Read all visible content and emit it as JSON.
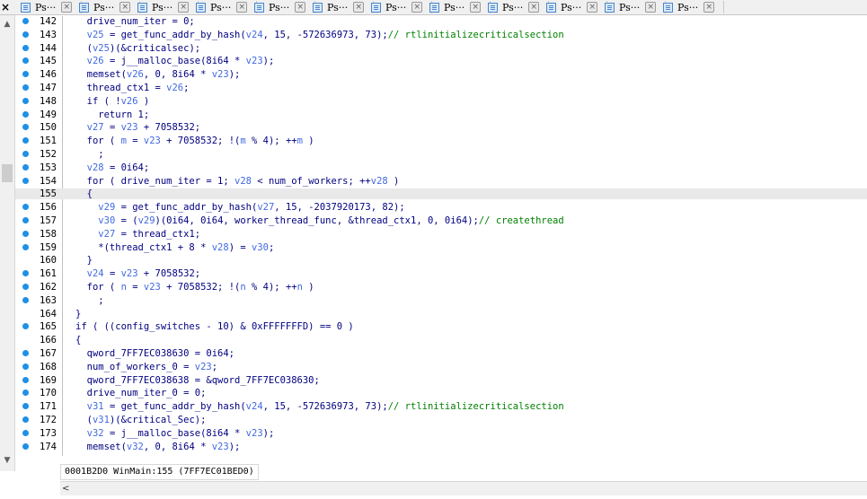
{
  "window_controls": {
    "close_glyph": "×"
  },
  "tabs": [
    {
      "label": "Ps···"
    },
    {
      "label": "Ps···"
    },
    {
      "label": "Ps···"
    },
    {
      "label": "Ps···"
    },
    {
      "label": "Ps···"
    },
    {
      "label": "Ps···"
    },
    {
      "label": "Ps···"
    },
    {
      "label": "Ps···"
    },
    {
      "label": "Ps···"
    },
    {
      "label": "Ps···"
    },
    {
      "label": "Ps···"
    },
    {
      "label": "Ps···"
    }
  ],
  "scrollbar": {
    "up_glyph": "▲",
    "down_glyph": "▼",
    "left_glyph": "<"
  },
  "code_lines": [
    {
      "num": "142",
      "bp": true,
      "segs": [
        [
          "k",
          "  drive_num_iter = 0;"
        ]
      ]
    },
    {
      "num": "143",
      "bp": true,
      "segs": [
        [
          "k",
          "  "
        ],
        [
          "v",
          "v25"
        ],
        [
          "k",
          " = get_func_addr_by_hash("
        ],
        [
          "v",
          "v24"
        ],
        [
          "k",
          ", 15, -572636973, 73);"
        ],
        [
          "c",
          "// rtlinitializecriticalsection"
        ]
      ]
    },
    {
      "num": "144",
      "bp": true,
      "segs": [
        [
          "k",
          "  ("
        ],
        [
          "v",
          "v25"
        ],
        [
          "k",
          ")(&criticalsec);"
        ]
      ]
    },
    {
      "num": "145",
      "bp": true,
      "segs": [
        [
          "k",
          "  "
        ],
        [
          "v",
          "v26"
        ],
        [
          "k",
          " = j__malloc_base(8i64 * "
        ],
        [
          "v",
          "v23"
        ],
        [
          "k",
          ");"
        ]
      ]
    },
    {
      "num": "146",
      "bp": true,
      "segs": [
        [
          "k",
          "  memset("
        ],
        [
          "v",
          "v26"
        ],
        [
          "k",
          ", 0, 8i64 * "
        ],
        [
          "v",
          "v23"
        ],
        [
          "k",
          ");"
        ]
      ]
    },
    {
      "num": "147",
      "bp": true,
      "segs": [
        [
          "k",
          "  thread_ctx1 = "
        ],
        [
          "v",
          "v26"
        ],
        [
          "k",
          ";"
        ]
      ]
    },
    {
      "num": "148",
      "bp": true,
      "segs": [
        [
          "k",
          "  if ( !"
        ],
        [
          "v",
          "v26"
        ],
        [
          "k",
          " )"
        ]
      ]
    },
    {
      "num": "149",
      "bp": true,
      "segs": [
        [
          "k",
          "    return 1;"
        ]
      ]
    },
    {
      "num": "150",
      "bp": true,
      "segs": [
        [
          "k",
          "  "
        ],
        [
          "v",
          "v27"
        ],
        [
          "k",
          " = "
        ],
        [
          "v",
          "v23"
        ],
        [
          "k",
          " + 7058532;"
        ]
      ]
    },
    {
      "num": "151",
      "bp": true,
      "segs": [
        [
          "k",
          "  for ( "
        ],
        [
          "v",
          "m"
        ],
        [
          "k",
          " = "
        ],
        [
          "v",
          "v23"
        ],
        [
          "k",
          " + 7058532; !("
        ],
        [
          "v",
          "m"
        ],
        [
          "k",
          " % 4); ++"
        ],
        [
          "v",
          "m"
        ],
        [
          "k",
          " )"
        ]
      ]
    },
    {
      "num": "152",
      "bp": true,
      "segs": [
        [
          "k",
          "    ;"
        ]
      ]
    },
    {
      "num": "153",
      "bp": true,
      "segs": [
        [
          "k",
          "  "
        ],
        [
          "v",
          "v28"
        ],
        [
          "k",
          " = 0i64;"
        ]
      ]
    },
    {
      "num": "154",
      "bp": true,
      "segs": [
        [
          "k",
          "  for ( drive_num_iter = 1; "
        ],
        [
          "v",
          "v28"
        ],
        [
          "k",
          " < num_of_workers; ++"
        ],
        [
          "v",
          "v28"
        ],
        [
          "k",
          " )"
        ]
      ]
    },
    {
      "num": "155",
      "bp": false,
      "hl": true,
      "segs": [
        [
          "k",
          "  {"
        ]
      ]
    },
    {
      "num": "156",
      "bp": true,
      "segs": [
        [
          "k",
          "    "
        ],
        [
          "v",
          "v29"
        ],
        [
          "k",
          " = get_func_addr_by_hash("
        ],
        [
          "v",
          "v27"
        ],
        [
          "k",
          ", 15, -2037920173, 82);"
        ]
      ]
    },
    {
      "num": "157",
      "bp": true,
      "segs": [
        [
          "k",
          "    "
        ],
        [
          "v",
          "v30"
        ],
        [
          "k",
          " = ("
        ],
        [
          "v",
          "v29"
        ],
        [
          "k",
          ")(0i64, 0i64, worker_thread_func, &thread_ctx1, 0, 0i64);"
        ],
        [
          "c",
          "// createthread"
        ]
      ]
    },
    {
      "num": "158",
      "bp": true,
      "segs": [
        [
          "k",
          "    "
        ],
        [
          "v",
          "v27"
        ],
        [
          "k",
          " = thread_ctx1;"
        ]
      ]
    },
    {
      "num": "159",
      "bp": true,
      "segs": [
        [
          "k",
          "    *(thread_ctx1 + 8 * "
        ],
        [
          "v",
          "v28"
        ],
        [
          "k",
          ") = "
        ],
        [
          "v",
          "v30"
        ],
        [
          "k",
          ";"
        ]
      ]
    },
    {
      "num": "160",
      "bp": false,
      "segs": [
        [
          "k",
          "  }"
        ]
      ]
    },
    {
      "num": "161",
      "bp": true,
      "segs": [
        [
          "k",
          "  "
        ],
        [
          "v",
          "v24"
        ],
        [
          "k",
          " = "
        ],
        [
          "v",
          "v23"
        ],
        [
          "k",
          " + 7058532;"
        ]
      ]
    },
    {
      "num": "162",
      "bp": true,
      "segs": [
        [
          "k",
          "  for ( "
        ],
        [
          "v",
          "n"
        ],
        [
          "k",
          " = "
        ],
        [
          "v",
          "v23"
        ],
        [
          "k",
          " + 7058532; !("
        ],
        [
          "v",
          "n"
        ],
        [
          "k",
          " % 4); ++"
        ],
        [
          "v",
          "n"
        ],
        [
          "k",
          " )"
        ]
      ]
    },
    {
      "num": "163",
      "bp": true,
      "segs": [
        [
          "k",
          "    ;"
        ]
      ]
    },
    {
      "num": "164",
      "bp": false,
      "segs": [
        [
          "k",
          "}"
        ]
      ]
    },
    {
      "num": "165",
      "bp": true,
      "segs": [
        [
          "k",
          "if ( ((config_switches - 10) & 0xFFFFFFFD) == 0 )"
        ]
      ]
    },
    {
      "num": "166",
      "bp": false,
      "segs": [
        [
          "k",
          "{"
        ]
      ]
    },
    {
      "num": "167",
      "bp": true,
      "segs": [
        [
          "k",
          "  qword_7FF7EC038630 = 0i64;"
        ]
      ]
    },
    {
      "num": "168",
      "bp": true,
      "segs": [
        [
          "k",
          "  num_of_workers_0 = "
        ],
        [
          "v",
          "v23"
        ],
        [
          "k",
          ";"
        ]
      ]
    },
    {
      "num": "169",
      "bp": true,
      "segs": [
        [
          "k",
          "  qword_7FF7EC038638 = &qword_7FF7EC038630;"
        ]
      ]
    },
    {
      "num": "170",
      "bp": true,
      "segs": [
        [
          "k",
          "  drive_num_iter_0 = 0;"
        ]
      ]
    },
    {
      "num": "171",
      "bp": true,
      "segs": [
        [
          "k",
          "  "
        ],
        [
          "v",
          "v31"
        ],
        [
          "k",
          " = get_func_addr_by_hash("
        ],
        [
          "v",
          "v24"
        ],
        [
          "k",
          ", 15, -572636973, 73);"
        ],
        [
          "c",
          "// rtlinitializecriticalsection"
        ]
      ]
    },
    {
      "num": "172",
      "bp": true,
      "segs": [
        [
          "k",
          "  ("
        ],
        [
          "v",
          "v31"
        ],
        [
          "k",
          ")(&critical_Sec);"
        ]
      ]
    },
    {
      "num": "173",
      "bp": true,
      "segs": [
        [
          "k",
          "  "
        ],
        [
          "v",
          "v32"
        ],
        [
          "k",
          " = j__malloc_base(8i64 * "
        ],
        [
          "v",
          "v23"
        ],
        [
          "k",
          ");"
        ]
      ]
    },
    {
      "num": "174",
      "bp": true,
      "segs": [
        [
          "k",
          "  memset("
        ],
        [
          "v",
          "v32"
        ],
        [
          "k",
          ", 0, 8i64 * "
        ],
        [
          "v",
          "v23"
        ],
        [
          "k",
          ");"
        ]
      ]
    }
  ],
  "status": {
    "text": "0001B2D0 WinMain:155 (7FF7EC01BED0)"
  },
  "colors": {
    "keyword_text": "#000080",
    "variable": "#4169e1",
    "comment": "#008000",
    "breakpoint_dot": "#1e90e6",
    "highlight_line": "#e9e9e9"
  }
}
